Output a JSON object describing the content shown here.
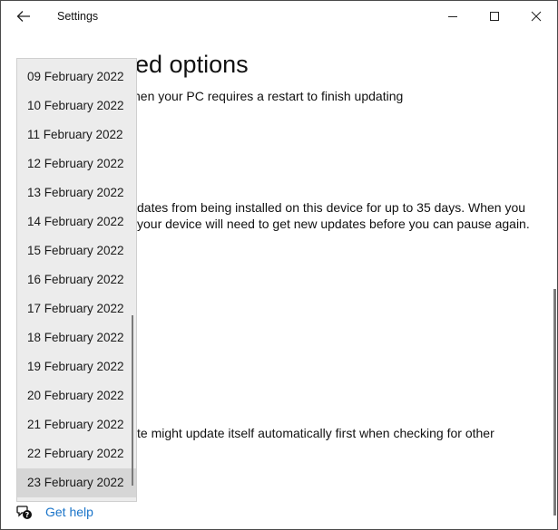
{
  "window": {
    "title": "Settings",
    "icons": {
      "back": "arrow-left-icon",
      "minimize": "minimize-icon",
      "maximize": "maximize-icon",
      "close": "close-icon"
    }
  },
  "page": {
    "heading_visible": "ed options",
    "lines": [
      "hen your PC requires a restart to finish updating",
      "dates from being installed on this device for up to 35 days. When you",
      " your device will need to get new updates before you can pause again.",
      "te might update itself automatically first when checking for other"
    ]
  },
  "dropdown": {
    "items": [
      "09 February 2022",
      "10 February 2022",
      "11 February 2022",
      "12 February 2022",
      "13 February 2022",
      "14 February 2022",
      "15 February 2022",
      "16 February 2022",
      "17 February 2022",
      "18 February 2022",
      "19 February 2022",
      "20 February 2022",
      "21 February 2022",
      "22 February 2022",
      "23 February 2022"
    ],
    "selected": "23 February 2022"
  },
  "footer": {
    "help_label": "Get help",
    "help_icon": "chat-help-icon"
  }
}
